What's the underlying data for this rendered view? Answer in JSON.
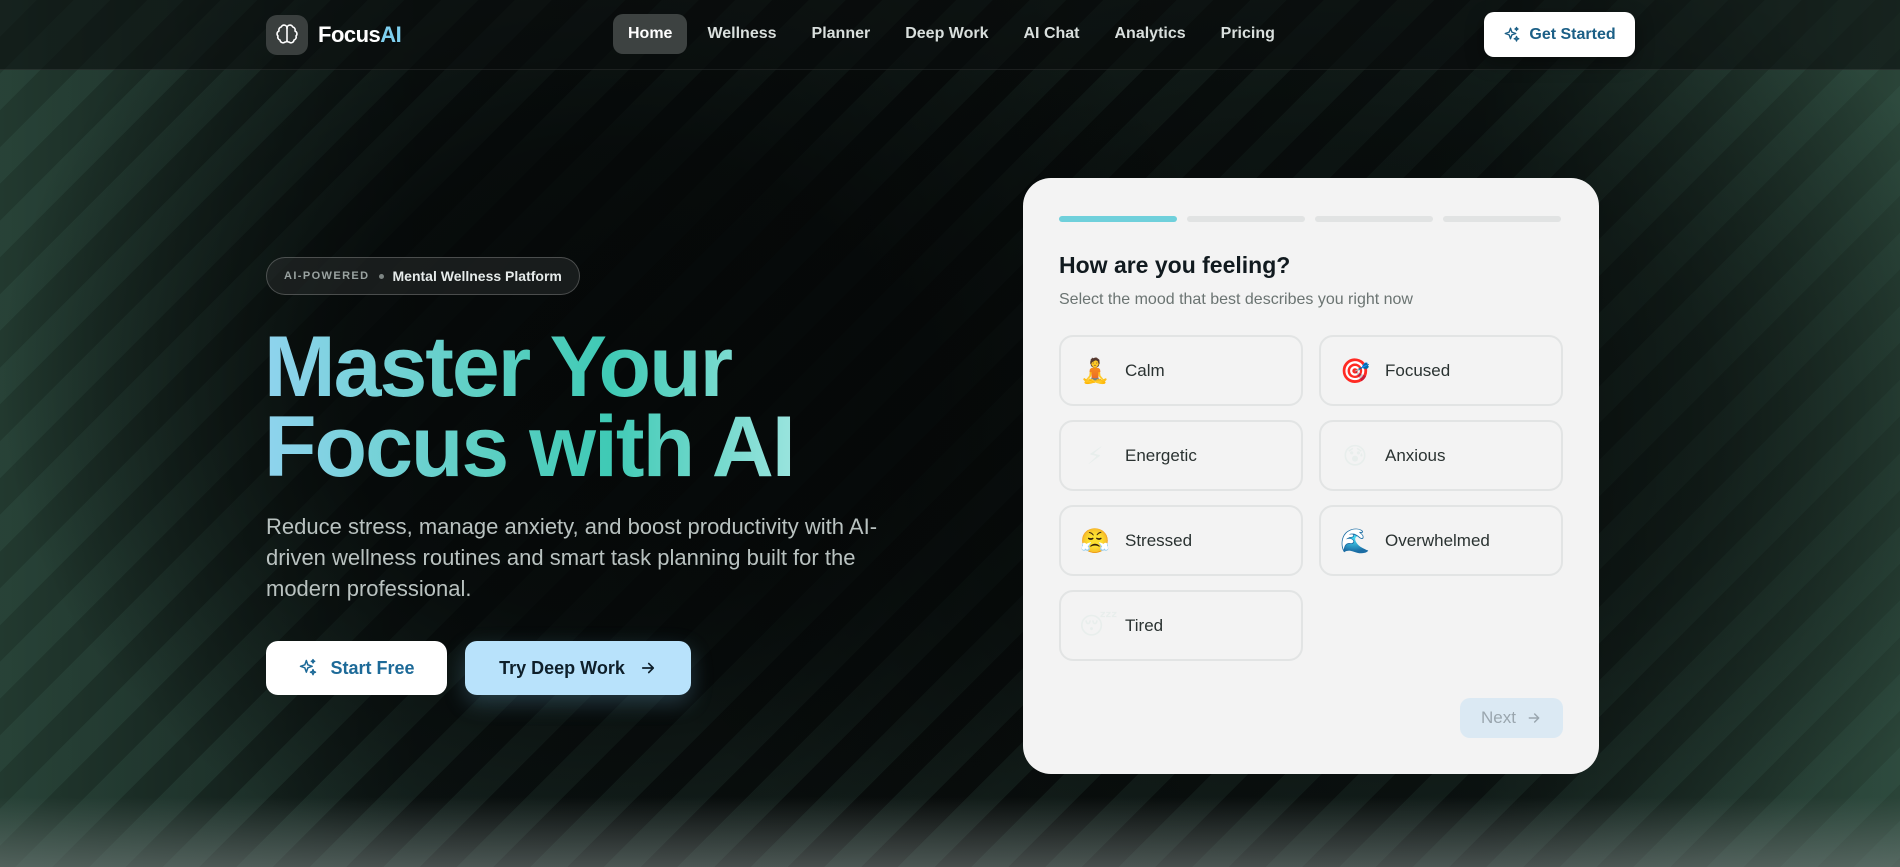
{
  "brand": {
    "name_part1": "Focus",
    "name_part2": "AI"
  },
  "nav": {
    "items": [
      {
        "label": "Home",
        "active": true
      },
      {
        "label": "Wellness"
      },
      {
        "label": "Planner"
      },
      {
        "label": "Deep Work"
      },
      {
        "label": "AI Chat"
      },
      {
        "label": "Analytics"
      },
      {
        "label": "Pricing"
      }
    ],
    "cta_label": "Get Started"
  },
  "hero": {
    "badge_tag": "AI-POWERED",
    "badge_text": "Mental Wellness Platform",
    "headline_line1": "Master Your",
    "headline_line2": "Focus with AI",
    "subheadline": "Reduce stress, manage anxiety, and boost productivity with AI-driven wellness routines and smart task planning built for the modern professional.",
    "primary_button": "Start Free",
    "secondary_button": "Try Deep Work"
  },
  "mood_card": {
    "progress": {
      "current_step": 1,
      "total_steps": 4
    },
    "title": "How are you feeling?",
    "subtitle": "Select the mood that best describes you right now",
    "moods": [
      {
        "label": "Calm",
        "emoji": "🧘"
      },
      {
        "label": "Focused",
        "emoji": "🎯"
      },
      {
        "label": "Energetic",
        "emoji": "⚡"
      },
      {
        "label": "Anxious",
        "emoji": "😰"
      },
      {
        "label": "Stressed",
        "emoji": "😤"
      },
      {
        "label": "Overwhelmed",
        "emoji": "🌊"
      },
      {
        "label": "Tired",
        "emoji": "😴"
      }
    ],
    "next_label": "Next"
  },
  "colors": {
    "accent_teal": "#5fd0c4",
    "accent_blue": "#8fd3ee",
    "button_light_blue": "#b8e2fb",
    "progress_active": "#6fd0db"
  }
}
